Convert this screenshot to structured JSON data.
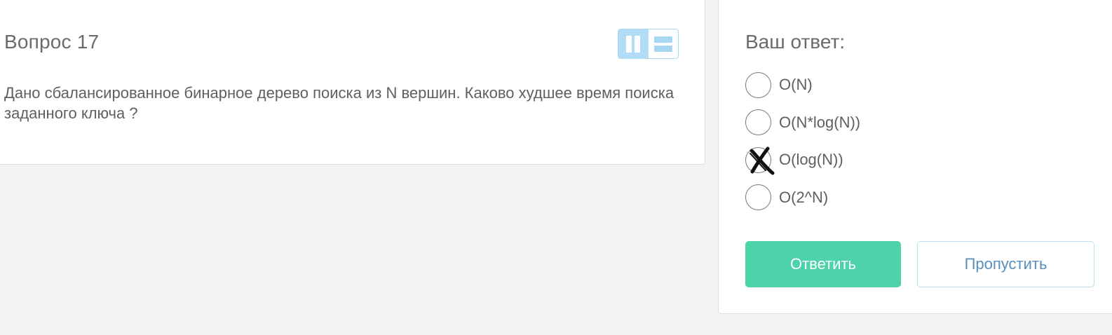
{
  "question": {
    "title": "Вопрос 17",
    "text": "Дано сбалансированное бинарное дерево поиска из N вершин. Каково худшее время поиска заданного ключа ?",
    "layout_toggle": {
      "options": [
        {
          "icon": "columns-layout-icon",
          "active": true
        },
        {
          "icon": "rows-layout-icon",
          "active": false
        }
      ],
      "accent_color": "#b3ddf7"
    }
  },
  "answer": {
    "heading": "Ваш ответ:",
    "options": [
      {
        "label": "O(N)",
        "marked": false
      },
      {
        "label": "O(N*log(N))",
        "marked": false
      },
      {
        "label": "O(log(N))",
        "marked": true,
        "mark_icon": "handwritten-x-icon"
      },
      {
        "label": "O(2^N)",
        "marked": false
      }
    ],
    "submit_label": "Ответить",
    "skip_label": "Пропустить"
  },
  "colors": {
    "submit_bg": "#4cd3aa",
    "skip_text": "#5a8fbd",
    "page_bg": "#f3f3f3"
  }
}
